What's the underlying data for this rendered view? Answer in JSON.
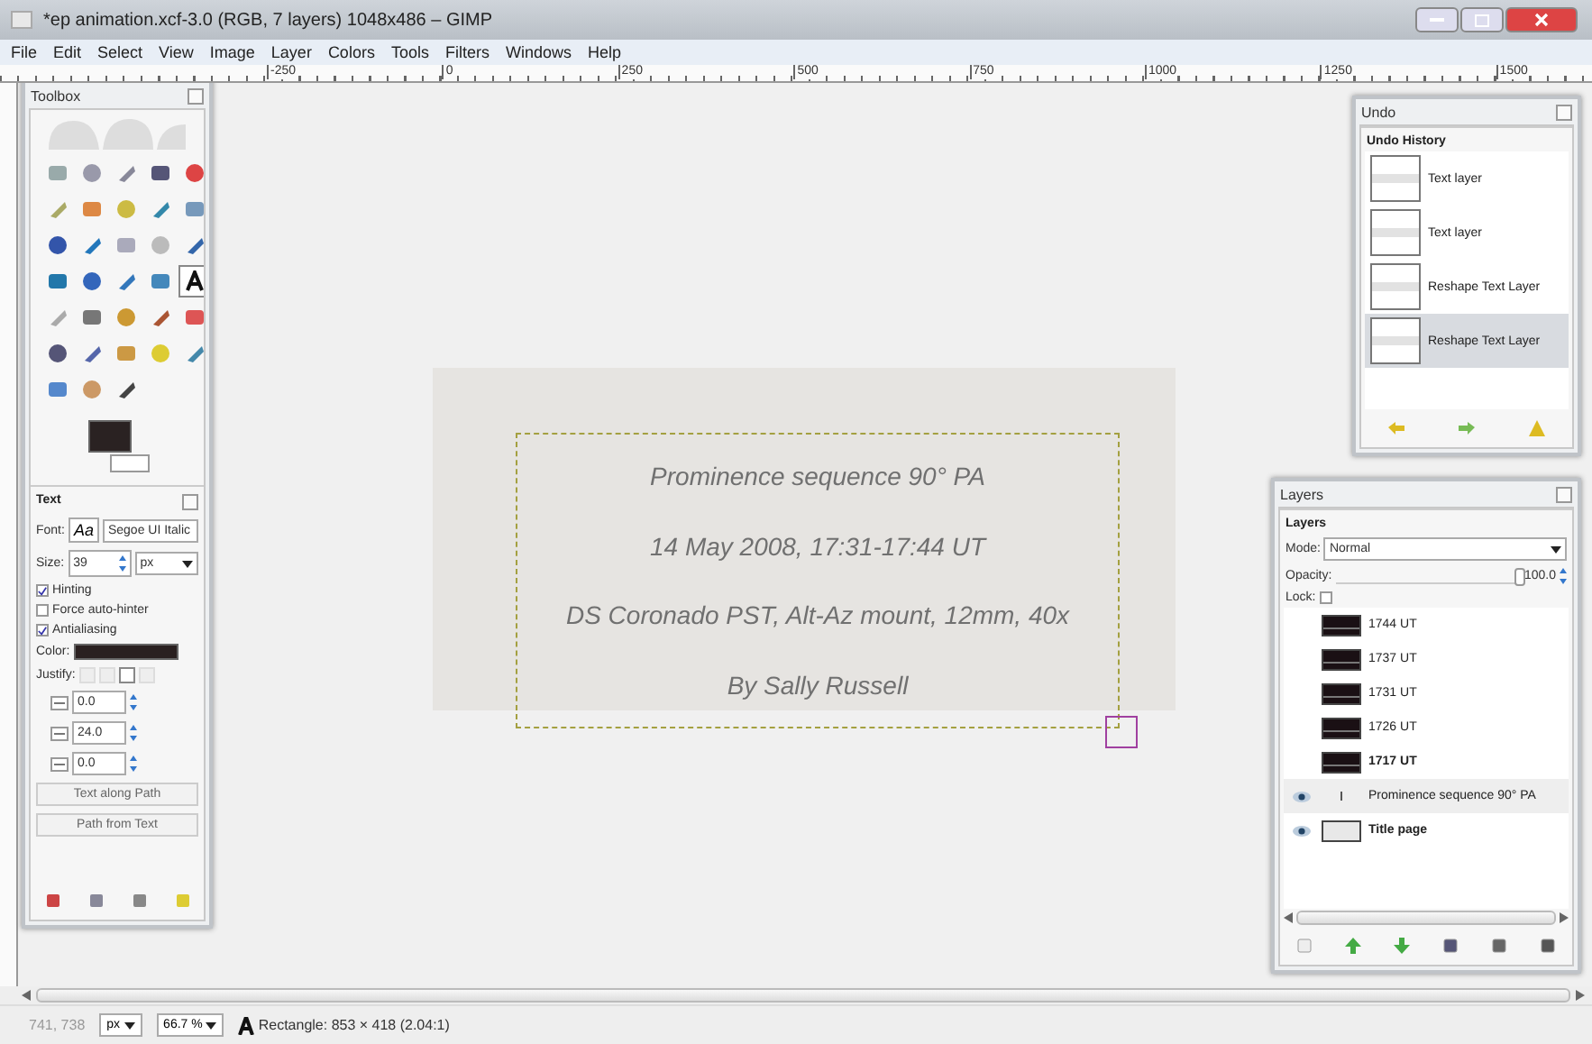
{
  "window": {
    "title": "*ep animation.xcf-3.0 (RGB, 7 layers) 1048x486 – GIMP"
  },
  "menu": [
    "File",
    "Edit",
    "Select",
    "View",
    "Image",
    "Layer",
    "Colors",
    "Tools",
    "Filters",
    "Windows",
    "Help"
  ],
  "ruler": [
    "-250",
    "0",
    "250",
    "500",
    "750",
    "1000",
    "1250",
    "1500"
  ],
  "canvas": {
    "lines": [
      "Prominence sequence 90° PA",
      "14 May 2008, 17:31-17:44 UT",
      "DS Coronado PST, Alt-Az mount, 12mm, 40x",
      "By Sally Russell"
    ]
  },
  "toolbox": {
    "title": "Toolbox",
    "tools": [
      {
        "selected": false
      },
      {
        "selected": false
      },
      {
        "selected": false
      },
      {
        "selected": false
      },
      {
        "selected": false
      },
      {
        "selected": false
      },
      {
        "selected": false
      },
      {
        "selected": false
      },
      {
        "selected": false
      },
      {
        "selected": false
      },
      {
        "selected": false
      },
      {
        "selected": false
      },
      {
        "selected": false
      },
      {
        "selected": false
      },
      {
        "selected": false
      },
      {
        "selected": false
      },
      {
        "selected": false
      },
      {
        "selected": false
      },
      {
        "selected": false
      },
      {
        "selected": true
      },
      {
        "selected": false
      },
      {
        "selected": false
      },
      {
        "selected": false
      },
      {
        "selected": false
      },
      {
        "selected": false
      },
      {
        "selected": false
      },
      {
        "selected": false
      },
      {
        "selected": false
      },
      {
        "selected": false
      },
      {
        "selected": false
      },
      {
        "selected": false
      },
      {
        "selected": false
      },
      {
        "selected": false
      }
    ],
    "options": {
      "title": "Text",
      "font_label": "Font:",
      "font_preview": "Aa",
      "font": "Segoe UI Italic",
      "size_label": "Size:",
      "size": "39",
      "unit": "px",
      "checkboxes": [
        {
          "label": "Hinting",
          "checked": true
        },
        {
          "label": "Force auto-hinter",
          "checked": false
        },
        {
          "label": "Antialiasing",
          "checked": true
        }
      ],
      "color_label": "Color:",
      "justify_label": "Justify:",
      "justify": [
        {
          "selected": false
        },
        {
          "selected": false
        },
        {
          "selected": true
        },
        {
          "selected": false
        }
      ],
      "spinners": [
        "0.0",
        "24.0",
        "0.0"
      ],
      "buttons": [
        "Text along Path",
        "Path from Text"
      ]
    }
  },
  "undo": {
    "title": "Undo",
    "header": "Undo History",
    "items": [
      {
        "label": "Text layer",
        "selected": false
      },
      {
        "label": "Text layer",
        "selected": false
      },
      {
        "label": "Reshape Text Layer",
        "selected": false
      },
      {
        "label": "Reshape Text Layer",
        "selected": true
      }
    ]
  },
  "layers": {
    "title": "Layers",
    "header": "Layers",
    "mode_label": "Mode:",
    "mode": "Normal",
    "opacity_label": "Opacity:",
    "opacity": {
      "value": "100.0",
      "level": 1
    },
    "lock_label": "Lock:",
    "lock_checked": false,
    "items": [
      {
        "name": "1744 UT",
        "kind": "image",
        "visible": false,
        "bold": false,
        "selected": false
      },
      {
        "name": "1737 UT",
        "kind": "image",
        "visible": false,
        "bold": false,
        "selected": false
      },
      {
        "name": "1731 UT",
        "kind": "image",
        "visible": false,
        "bold": false,
        "selected": false
      },
      {
        "name": "1726 UT",
        "kind": "image",
        "visible": false,
        "bold": false,
        "selected": false
      },
      {
        "name": "1717 UT",
        "kind": "image",
        "visible": false,
        "bold": true,
        "selected": false
      },
      {
        "name": "Prominence sequence 90° PA",
        "kind": "text",
        "visible": true,
        "bold": false,
        "selected": true
      },
      {
        "name": "Title page",
        "kind": "page",
        "visible": true,
        "bold": true,
        "selected": false
      }
    ]
  },
  "status": {
    "coords": "741, 738",
    "unit": "px",
    "zoom": "66.7 %",
    "message": "Rectangle: 853 × 418  (2.04:1)"
  }
}
